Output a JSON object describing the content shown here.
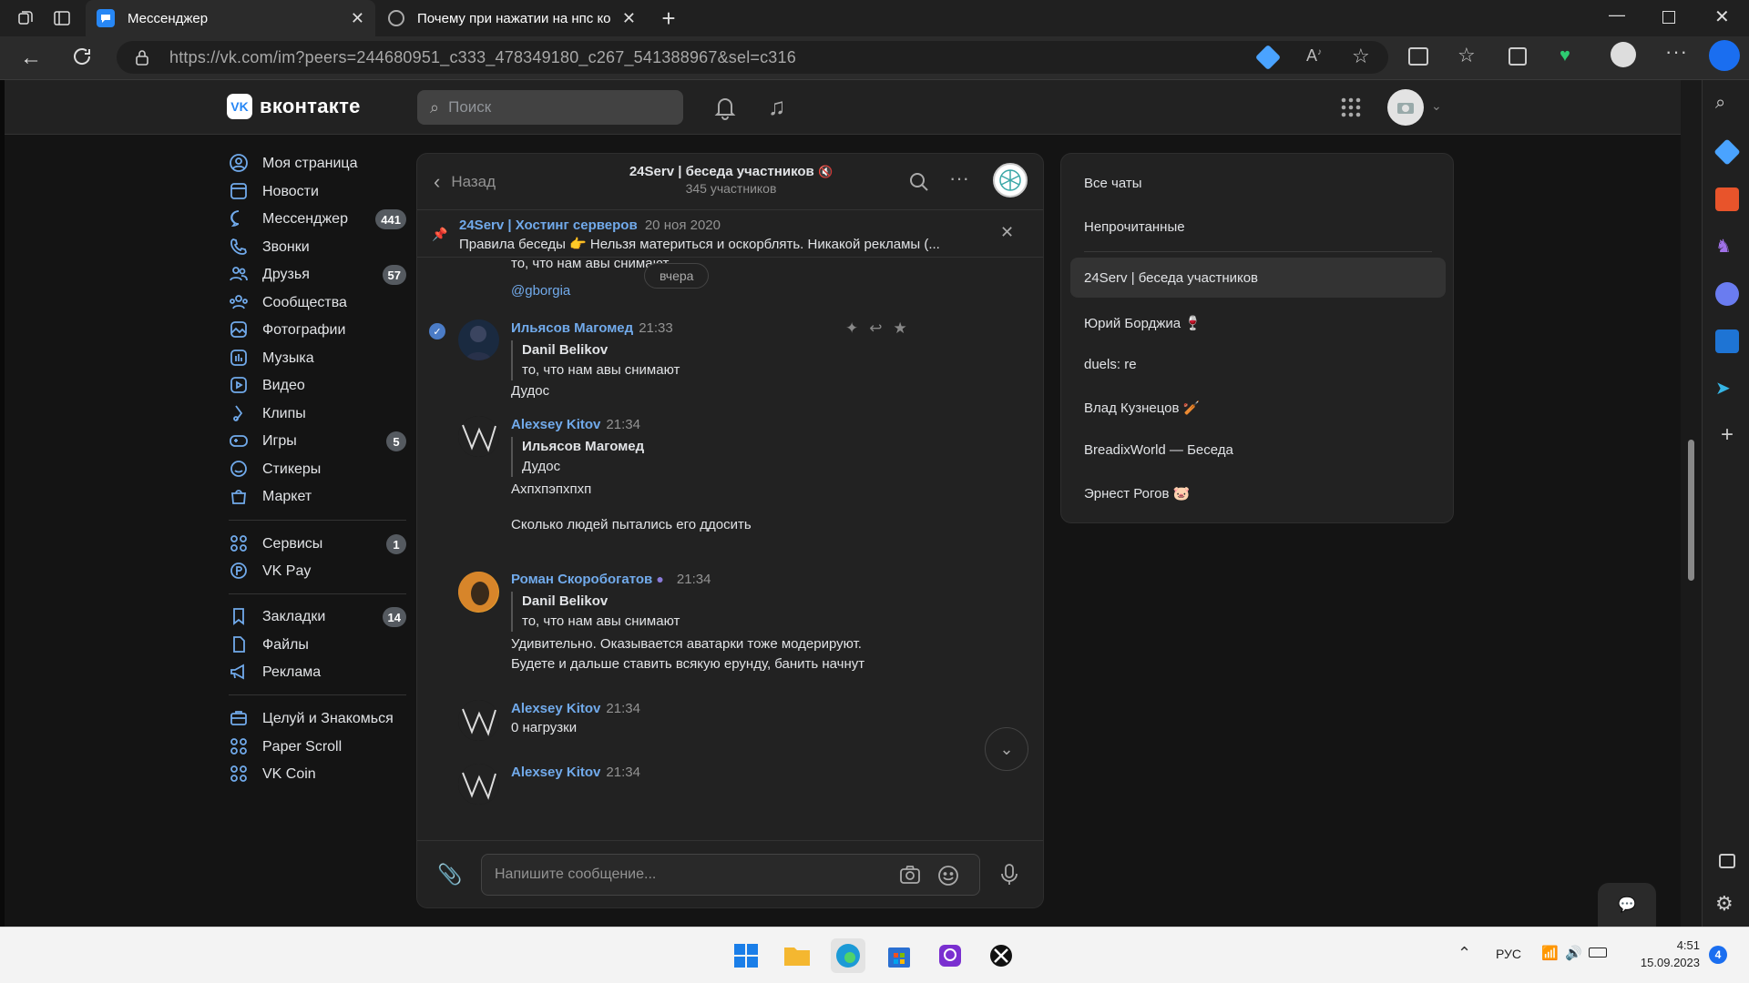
{
  "browser": {
    "tabs": [
      {
        "title": "Мессенджер",
        "active": true
      },
      {
        "title": "Почему при нажатии на нпс ко",
        "active": false
      }
    ],
    "url": "https://vk.com/im?peers=244680951_c333_478349180_c267_541388967&sel=c316"
  },
  "vk": {
    "logo_text": "вконтакте",
    "search_placeholder": "Поиск"
  },
  "nav": {
    "items": [
      {
        "label": "Моя страница",
        "icon": "user-circle-icon"
      },
      {
        "label": "Новости",
        "icon": "newspaper-icon"
      },
      {
        "label": "Мессенджер",
        "icon": "message-icon",
        "badge": "441"
      },
      {
        "label": "Звонки",
        "icon": "phone-icon"
      },
      {
        "label": "Друзья",
        "icon": "friends-icon",
        "badge": "57"
      },
      {
        "label": "Сообщества",
        "icon": "communities-icon"
      },
      {
        "label": "Фотографии",
        "icon": "photo-icon"
      },
      {
        "label": "Музыка",
        "icon": "music-icon"
      },
      {
        "label": "Видео",
        "icon": "video-icon"
      },
      {
        "label": "Клипы",
        "icon": "clips-icon"
      },
      {
        "label": "Игры",
        "icon": "gamepad-icon",
        "badge": "5"
      },
      {
        "label": "Стикеры",
        "icon": "sticker-icon"
      },
      {
        "label": "Маркет",
        "icon": "market-icon"
      }
    ],
    "services": [
      {
        "label": "Сервисы",
        "icon": "services-icon",
        "badge": "1"
      },
      {
        "label": "VK Pay",
        "icon": "vkpay-icon"
      }
    ],
    "misc": [
      {
        "label": "Закладки",
        "icon": "bookmark-icon",
        "badge": "14"
      },
      {
        "label": "Файлы",
        "icon": "file-icon"
      },
      {
        "label": "Реклама",
        "icon": "ads-icon"
      }
    ],
    "apps": [
      {
        "label": "Целуй и Знакомься",
        "icon": "app-icon"
      },
      {
        "label": "Paper Scroll",
        "icon": "app-icon"
      },
      {
        "label": "VK Coin",
        "icon": "app-icon"
      }
    ]
  },
  "chat": {
    "back_label": "Назад",
    "title": "24Serv | беседа участников",
    "subtitle": "345 участников",
    "pinned": {
      "author": "24Serv | Хостинг серверов",
      "date": "20 ноя 2020",
      "text": "Правила беседы 👉 Нельзя материться и оскорблять. Никакой рекламы (..."
    },
    "top_line": "то, что нам авы снимают",
    "date_divider": "вчера",
    "mention": "@gborgia",
    "messages": [
      {
        "author": "Ильясов Магомед",
        "time": "21:33",
        "quote_author": "Danil Belikov",
        "quote_text": "то, что нам авы снимают",
        "text": "Дудос"
      },
      {
        "author": "Alexsey Kitov",
        "time": "21:34",
        "quote_author": "Ильясов Магомед",
        "quote_text": "Дудос",
        "text": "Ахпхпэпхпхп",
        "text2": "Сколько людей пытались его ддосить"
      },
      {
        "author": "Роман Скоробогатов",
        "time": "21:34",
        "quote_author": "Danil Belikov",
        "quote_text": "то, что нам авы снимают",
        "text": "Удивительно. Оказывается аватарки тоже модерируют.",
        "text2": "Будете и дальше ставить всякую ерунду, банить начнут"
      },
      {
        "author": "Alexsey Kitov",
        "time": "21:34",
        "text": "0 нагрузки"
      },
      {
        "author": "Alexsey Kitov",
        "time": "21:34"
      }
    ],
    "input_placeholder": "Напишите сообщение..."
  },
  "chat_list": {
    "filters": [
      "Все чаты",
      "Непрочитанные"
    ],
    "items": [
      {
        "name": "24Serv | беседа участников",
        "selected": true
      },
      {
        "name": "Юрий Борджиа 🍷"
      },
      {
        "name": "duels: re"
      },
      {
        "name": "Влад Кузнецов 🏏"
      },
      {
        "name": "BreadixWorld — Беседа"
      },
      {
        "name": "Эрнест Рогов 🐷"
      }
    ]
  },
  "taskbar": {
    "lang": "РУС",
    "time": "4:51",
    "date": "15.09.2023",
    "notifications": "4"
  },
  "colors": {
    "accent": "#71aaeb",
    "background": "#141414",
    "panel": "#222222"
  }
}
